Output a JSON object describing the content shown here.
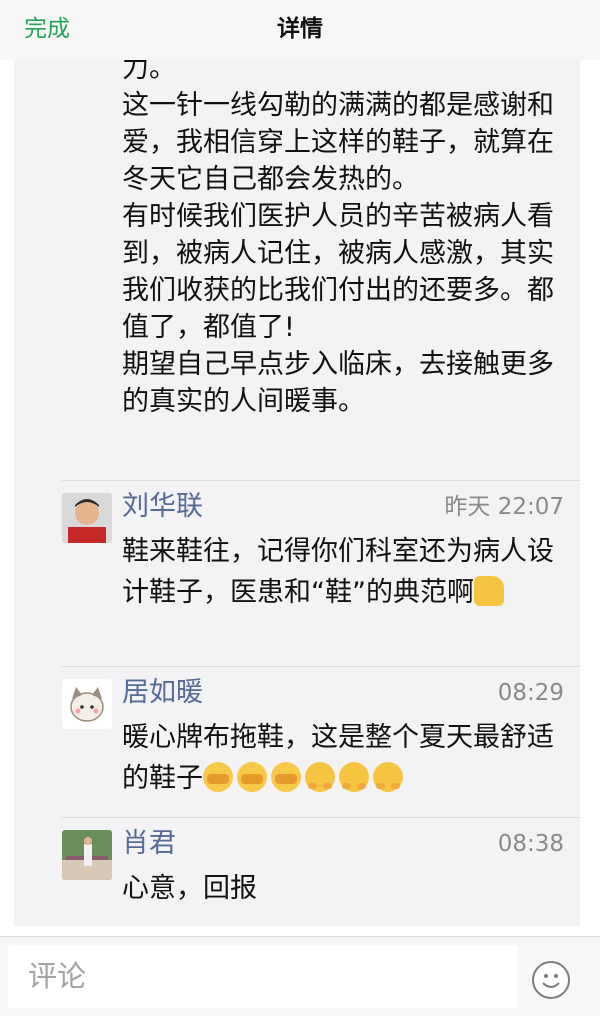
{
  "header": {
    "done_label": "完成",
    "title": "详情"
  },
  "post": {
    "lines": [
      "力。",
      "这一针一线勾勒的满满的都是感谢和爱，我相信穿上这样的鞋子，就算在冬天它自己都会发热的。",
      "有时候我们医护人员的辛苦被病人看到，被病人记住，被病人感激，其实我们收获的比我们付出的还要多。都值了，都值了!",
      "期望自己早点步入临床，去接触更多的真实的人间暖事。"
    ]
  },
  "comments": [
    {
      "name": "刘华联",
      "time": "昨天 22:07",
      "text": "鞋来鞋往，记得你们科室还为病人设计鞋子，医患和“鞋”的典范啊",
      "emojis": [
        "thumbs-up"
      ]
    },
    {
      "name": "居如暖",
      "time": "08:29",
      "text": "暖心牌布拖鞋，这是整个夏天最舒适的鞋子",
      "emojis": [
        "cover-mouth",
        "cover-mouth",
        "cover-mouth",
        "hug",
        "hug",
        "hug"
      ]
    },
    {
      "name": "肖君",
      "time": "08:38",
      "text": "心意，回报",
      "emojis": []
    }
  ],
  "footer": {
    "comment_placeholder": "评论",
    "emoji_icon": "smiley-icon"
  }
}
